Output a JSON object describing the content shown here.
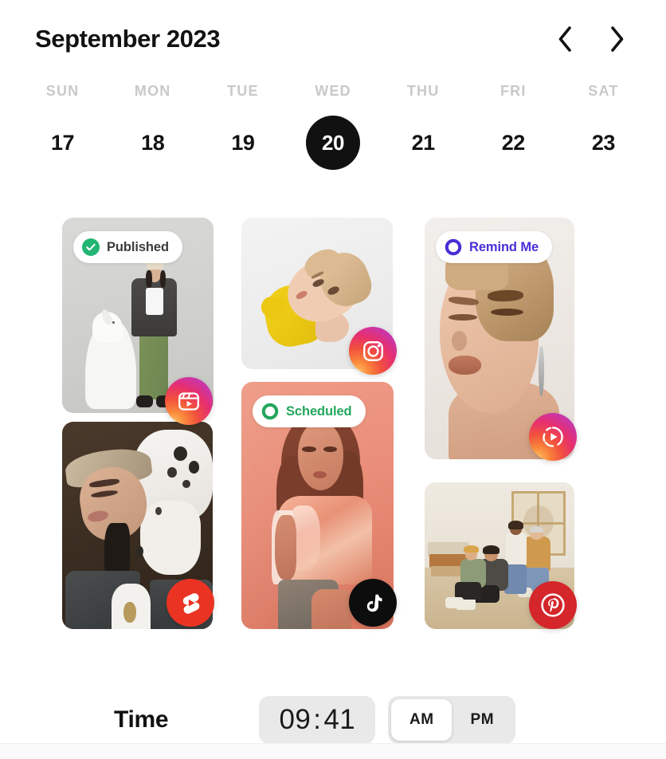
{
  "header": {
    "month_title": "September 2023",
    "prev_label": "Previous week",
    "next_label": "Next week"
  },
  "weekdays": [
    "SUN",
    "MON",
    "TUE",
    "WED",
    "THU",
    "FRI",
    "SAT"
  ],
  "dates": [
    {
      "day": "17",
      "selected": false
    },
    {
      "day": "18",
      "selected": false
    },
    {
      "day": "19",
      "selected": false
    },
    {
      "day": "20",
      "selected": true
    },
    {
      "day": "21",
      "selected": false
    },
    {
      "day": "22",
      "selected": false
    },
    {
      "day": "23",
      "selected": false
    }
  ],
  "posts": [
    {
      "id": "post-1",
      "status": "Published",
      "status_icon": "check-circle-filled-icon",
      "status_color": "#3c3c3c",
      "status_icon_color": "#22b573",
      "network": "instagram-reels-icon",
      "alt": "Woman in green pants and dark blazer standing beside a white dog on grey backdrop"
    },
    {
      "id": "post-2",
      "status": null,
      "network": "instagram-icon",
      "alt": "Portrait of a person with short blond hair wearing a yellow knit piece on white backdrop"
    },
    {
      "id": "post-3",
      "status": "Remind Me",
      "status_icon": "circle-outline-icon",
      "status_color": "#4b2ed6",
      "status_icon_color": "#4b2ed6",
      "network": "instagram-stories-icon",
      "alt": "Close-up portrait of a person with a short pixie cut and a long silver earring"
    },
    {
      "id": "post-4",
      "status": null,
      "network": "youtube-shorts-icon",
      "alt": "Woman in a cap with eyes closed leaning against a white spotted dog on brown backdrop"
    },
    {
      "id": "post-5",
      "status": "Scheduled",
      "status_icon": "circle-outline-icon",
      "status_color": "#23a65c",
      "status_icon_color": "#23a65c",
      "network": "tiktok-icon",
      "alt": "Woman in a satin top lit by warm red light against a coral backdrop"
    },
    {
      "id": "post-6",
      "status": null,
      "network": "pinterest-icon",
      "alt": "Four people sitting together on a sandy studio floor in a bright loft"
    }
  ],
  "time": {
    "label": "Time",
    "hour": "09",
    "separator": ":",
    "minute": "41",
    "meridiem_options": [
      "AM",
      "PM"
    ],
    "meridiem_selected": "AM"
  },
  "colors": {
    "selected_date_bg": "#111111",
    "published_green": "#22b573",
    "scheduled_green": "#23a65c",
    "remind_purple": "#4b2ed6",
    "youtube_red": "#ea3323",
    "pinterest_red": "#d4262b",
    "tiktok_black": "#0d0d0d",
    "muted_text": "#c9c9cc"
  }
}
